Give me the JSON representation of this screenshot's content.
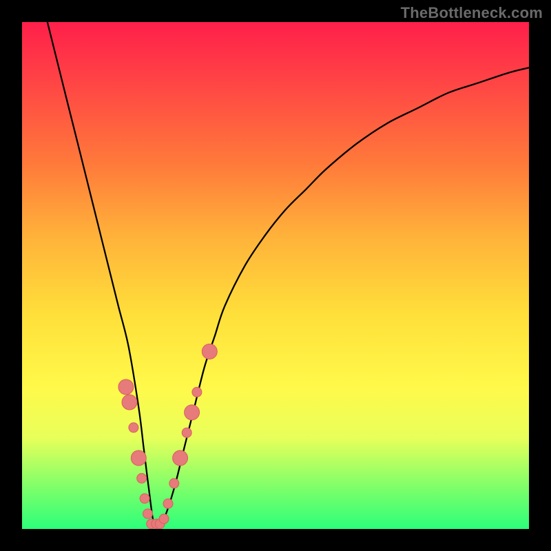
{
  "watermark": "TheBottleneck.com",
  "chart_data": {
    "type": "line",
    "title": "",
    "xlabel": "",
    "ylabel": "",
    "xlim": [
      0,
      100
    ],
    "ylim": [
      0,
      100
    ],
    "series": [
      {
        "name": "bottleneck-curve",
        "x": [
          5,
          7,
          9,
          11,
          13,
          15,
          17,
          19,
          21,
          23,
          24,
          25,
          26,
          27,
          28,
          30,
          32,
          34,
          36,
          38,
          40,
          44,
          48,
          52,
          56,
          60,
          66,
          72,
          78,
          84,
          90,
          96,
          100
        ],
        "values": [
          100,
          92,
          84,
          76,
          68,
          60,
          52,
          44,
          36,
          24,
          16,
          8,
          1,
          1,
          2,
          8,
          16,
          24,
          32,
          38,
          44,
          52,
          58,
          63,
          67,
          71,
          76,
          80,
          83,
          86,
          88,
          90,
          91
        ]
      }
    ],
    "markers": [
      {
        "x": 20.5,
        "y": 28
      },
      {
        "x": 21.2,
        "y": 25
      },
      {
        "x": 22.0,
        "y": 20
      },
      {
        "x": 23.0,
        "y": 14
      },
      {
        "x": 23.6,
        "y": 10
      },
      {
        "x": 24.2,
        "y": 6
      },
      {
        "x": 24.8,
        "y": 3
      },
      {
        "x": 25.5,
        "y": 1
      },
      {
        "x": 26.5,
        "y": 1
      },
      {
        "x": 27.2,
        "y": 1
      },
      {
        "x": 28.0,
        "y": 2
      },
      {
        "x": 28.8,
        "y": 5
      },
      {
        "x": 30.0,
        "y": 9
      },
      {
        "x": 31.2,
        "y": 14
      },
      {
        "x": 32.5,
        "y": 19
      },
      {
        "x": 33.5,
        "y": 23
      },
      {
        "x": 34.5,
        "y": 27
      },
      {
        "x": 37.0,
        "y": 35
      }
    ],
    "marker_style": {
      "fill": "#e77a7a",
      "stroke": "#d85f5f",
      "r_small": 7,
      "r_large": 11
    },
    "curve_style": {
      "stroke": "#000000",
      "width": 2.3
    }
  }
}
